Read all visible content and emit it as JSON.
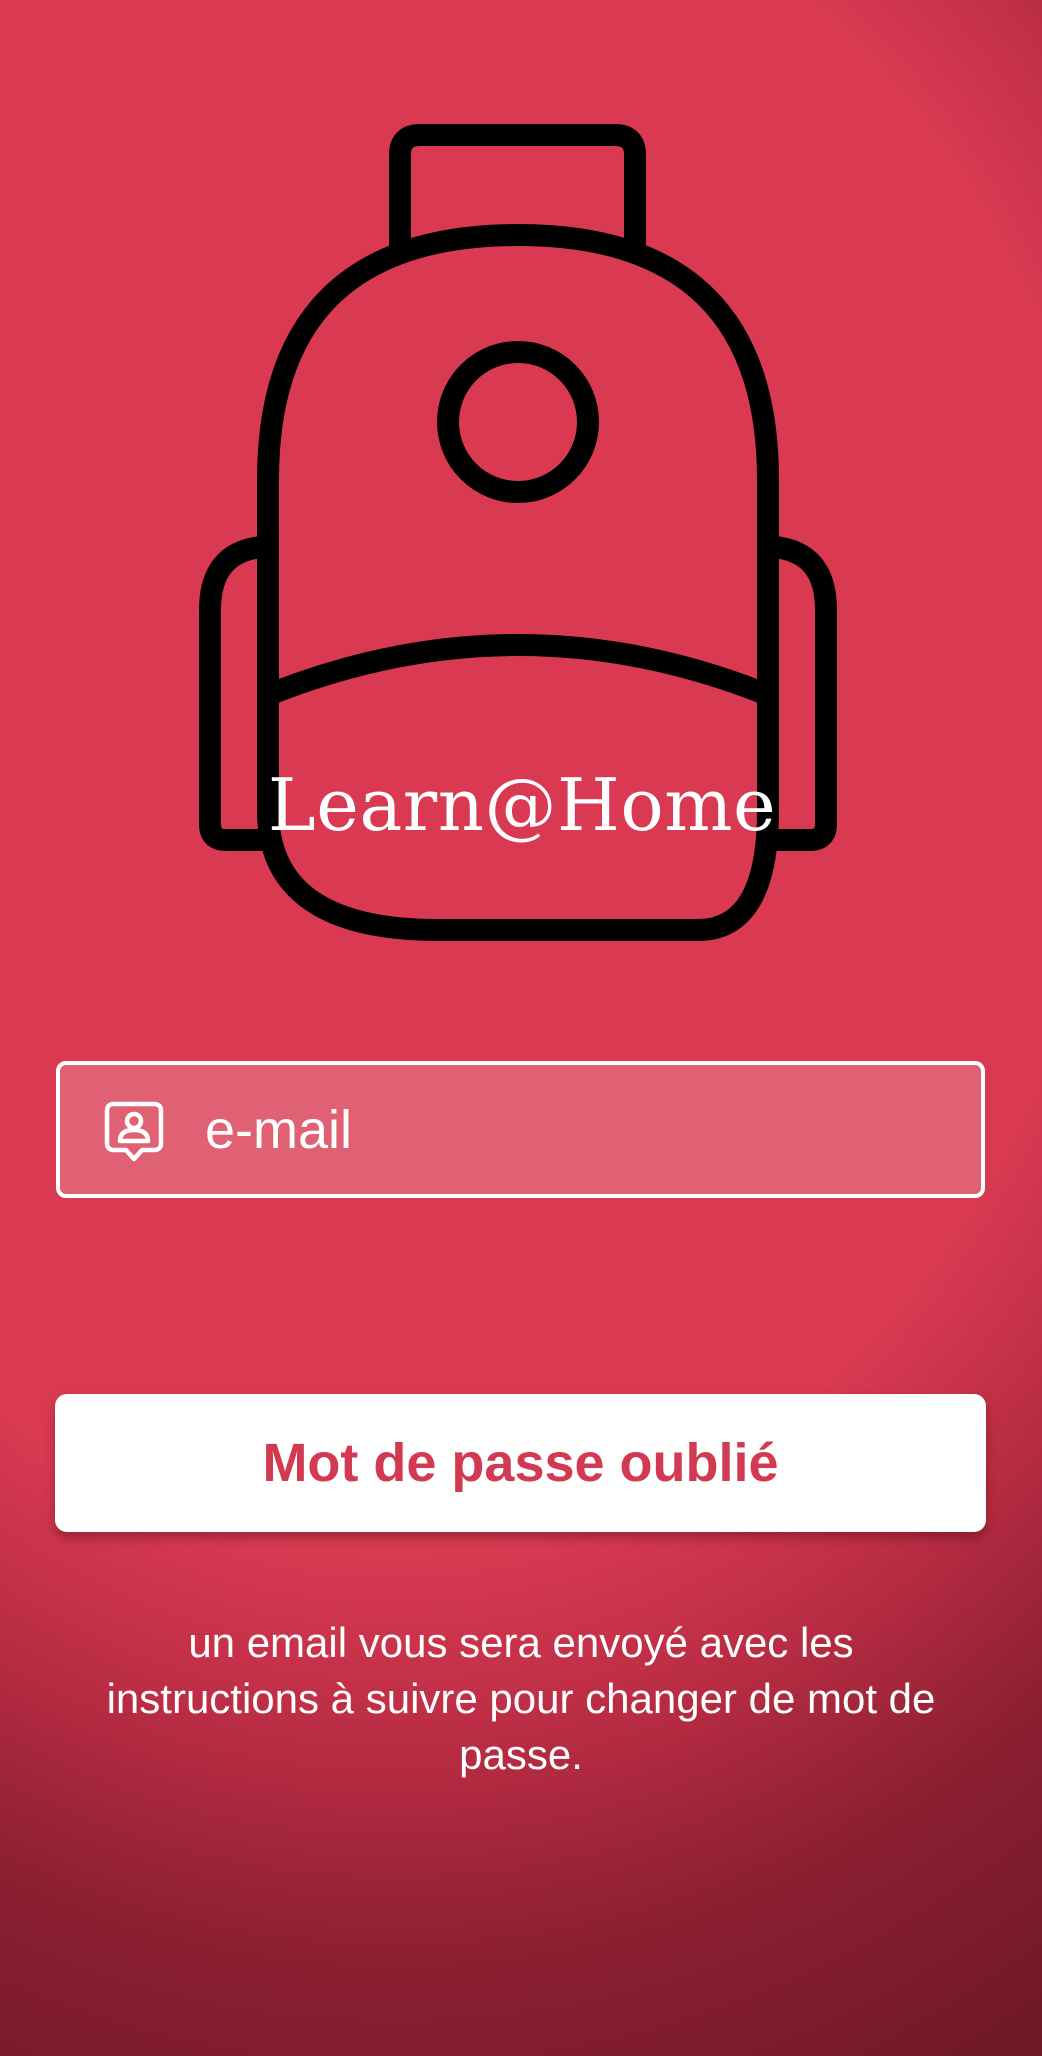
{
  "app": {
    "brand_name": "Learn@Home",
    "logo_icon": "backpack-icon"
  },
  "form": {
    "email_icon": "user-id-icon",
    "email_placeholder": "e-mail",
    "email_value": "",
    "submit_label": "Mot de passe oublié",
    "info_text": "un email vous sera envoyé avec les instructions à suivre pour changer de mot de passe."
  },
  "colors": {
    "background": "#d93a52",
    "background_dark": "#6e1828",
    "button_background": "#ffffff",
    "button_text": "#d23a52",
    "text": "#ffffff",
    "icon_stroke": "#000000"
  }
}
